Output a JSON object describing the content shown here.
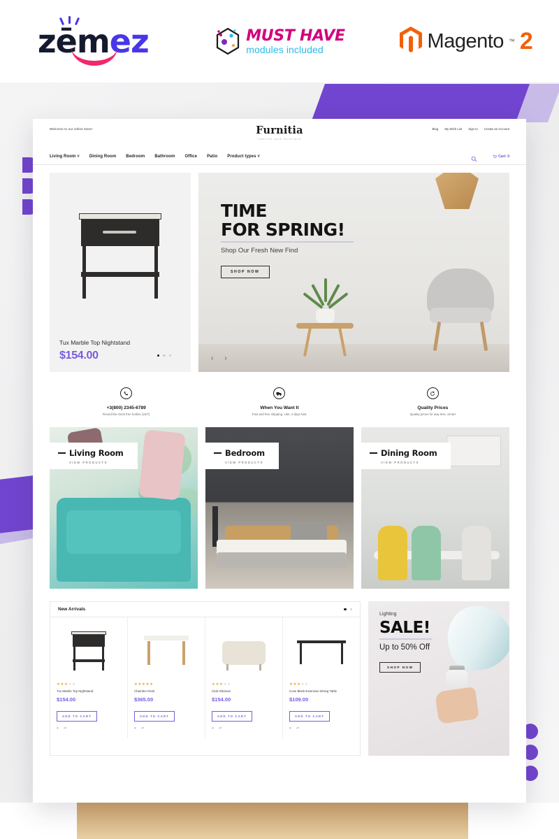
{
  "logo_strip": {
    "zemez": {
      "part1": "zēm",
      "part2": "ez",
      "alt": "Zemez"
    },
    "must_have": {
      "line1": "MUST HAVE",
      "line2": "modules included"
    },
    "magento": {
      "name": "Magento",
      "tm": "™",
      "version": "2"
    }
  },
  "site": {
    "topbar": {
      "welcome": "Welcome to our online store!",
      "links": [
        "Blog",
        "My Wish List",
        "Sign In",
        "Create an Account"
      ]
    },
    "brand": {
      "name": "Furnitia",
      "tagline": "interior and furniture"
    },
    "nav": {
      "items": [
        "Living Room",
        "Dining Room",
        "Bedroom",
        "Bathroom",
        "Office",
        "Patio",
        "Product types"
      ],
      "caret": "˅",
      "cart_label": "Cart: 0",
      "cart_icon": "🛒",
      "search_icon": "search-icon"
    },
    "promo": {
      "title": "Tux Marble Top Nightstand",
      "price": "$154.00",
      "dots": 3,
      "active_dot": 0
    },
    "banner": {
      "line1": "TIME",
      "line2": "FOR SPRING!",
      "subtitle": "Shop Our Fresh New Find",
      "button": "SHOP NOW",
      "prev": "‹",
      "next": "›"
    },
    "features": [
      {
        "icon": "phone-icon",
        "title": "+3(800) 2345-6789",
        "subtitle": "Round-the-clock free hotline (24/7)"
      },
      {
        "icon": "truck-icon",
        "title": "When You Want It",
        "subtitle": "Fast and free shipping. Like, 2 days fast."
      },
      {
        "icon": "refresh-icon",
        "title": "Quality Prices",
        "subtitle": "Quality prices for way less. Smart"
      }
    ],
    "categories": [
      {
        "title": "Living Room",
        "subtitle": "VIEW PRODUCTS"
      },
      {
        "title": "Bedroom",
        "subtitle": "VIEW PRODUCTS"
      },
      {
        "title": "Dining Room",
        "subtitle": "VIEW PRODUCTS"
      }
    ],
    "arrivals": {
      "title": "New Arrivals",
      "dots": 2,
      "active_dot": 0,
      "add_to_cart_label": "ADD TO CART",
      "wishlist_icon": "heart-icon",
      "compare_icon": "compare-icon",
      "products": [
        {
          "name": "Tux Marble Top Nightstand",
          "price": "$154.00",
          "rating": 3,
          "stars_total": 5
        },
        {
          "name": "Chamber Desk",
          "price": "$365.00",
          "rating": 5,
          "stars_total": 5
        },
        {
          "name": "Club Ottoman",
          "price": "$154.00",
          "rating": 3,
          "stars_total": 5
        },
        {
          "name": "Cove Black Extension Dining Table",
          "price": "$109.00",
          "rating": 3,
          "stars_total": 5
        }
      ]
    },
    "sale": {
      "kicker": "Lighting",
      "headline": "SALE!",
      "subtitle": "Up to 50% Off",
      "button": "SHOP NOW"
    }
  },
  "colors": {
    "accent_purple": "#7145cf",
    "price_purple": "#7a5bdd",
    "magento_orange": "#f2600c",
    "musthave_pink": "#d1007f",
    "musthave_blue": "#2bb9e8",
    "zemez_blue": "#4836e8",
    "zemez_pink": "#f2286d",
    "star_gold": "#f2a43a"
  }
}
